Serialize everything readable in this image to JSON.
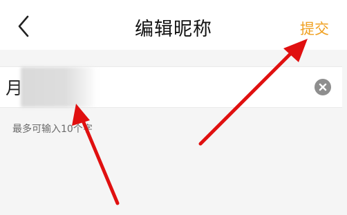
{
  "header": {
    "title": "编辑昵称",
    "submit_label": "提交",
    "back_icon": "chevron-left-icon",
    "submit_color": "#f0a020"
  },
  "nickname": {
    "value": "月"
  },
  "hint": "最多可输入10个字",
  "clear_icon": "clear-icon",
  "annotation_color": "#e01010"
}
